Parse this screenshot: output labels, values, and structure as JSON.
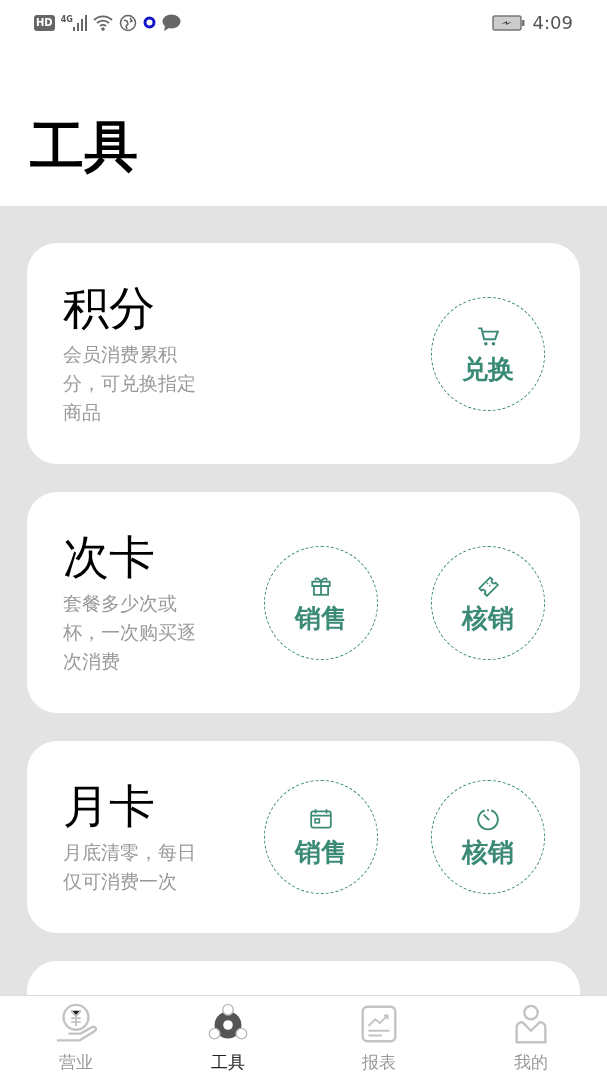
{
  "status_bar": {
    "badge": "HD",
    "network": "4G",
    "time": "4:09"
  },
  "page_title": "工具",
  "cards": [
    {
      "title": "积分",
      "description": "会员消费累积分，可兑换指定商品",
      "actions": [
        "兑换"
      ]
    },
    {
      "title": "次卡",
      "description": "套餐多少次或杯，一次购买逐次消费",
      "actions": [
        "销售",
        "核销"
      ]
    },
    {
      "title": "月卡",
      "description": "月底清零，每日仅可消费一次",
      "actions": [
        "销售",
        "核销"
      ]
    },
    {
      "kind": "partial"
    }
  ],
  "tabs": [
    {
      "label": "营业",
      "selected": false
    },
    {
      "label": "工具",
      "selected": true
    },
    {
      "label": "报表",
      "selected": false
    },
    {
      "label": "我的",
      "selected": false
    }
  ]
}
